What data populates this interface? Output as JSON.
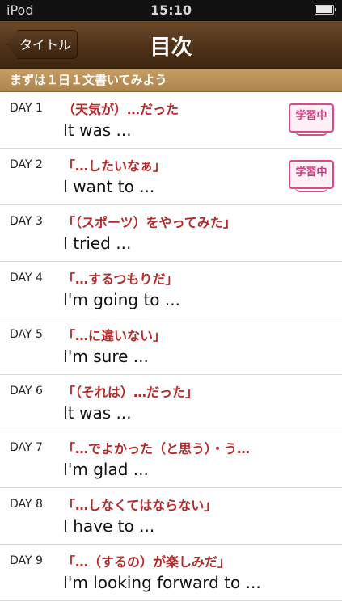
{
  "status_bar": {
    "device": "iPod",
    "time": "15:10",
    "battery_icon": "battery-icon"
  },
  "nav": {
    "back_label": "タイトル",
    "title": "目次"
  },
  "section": {
    "header": "まずは１日１文書いてみよう"
  },
  "rows": [
    {
      "day": "DAY 1",
      "jp": "（天気が）…だった",
      "en": "It was ...",
      "badge": "学習中"
    },
    {
      "day": "DAY 2",
      "jp": "「…したいなぁ」",
      "en": "I want to ...",
      "badge": "学習中"
    },
    {
      "day": "DAY 3",
      "jp": "「（スポーツ）をやってみた」",
      "en": "I tried ...",
      "badge": ""
    },
    {
      "day": "DAY 4",
      "jp": "「…するつもりだ」",
      "en": "I'm going to ...",
      "badge": ""
    },
    {
      "day": "DAY 5",
      "jp": "「…に違いない」",
      "en": "I'm sure ...",
      "badge": ""
    },
    {
      "day": "DAY 6",
      "jp": "「（それは）…だった」",
      "en": "It was ...",
      "badge": ""
    },
    {
      "day": "DAY 7",
      "jp": "「…でよかった（と思う）・う…",
      "en": "I'm glad ...",
      "badge": ""
    },
    {
      "day": "DAY 8",
      "jp": "「…しなくてはならない」",
      "en": "I have to ...",
      "badge": ""
    },
    {
      "day": "DAY 9",
      "jp": "「…（するの）が楽しみだ」",
      "en": "I'm looking forward to ...",
      "badge": ""
    }
  ],
  "colors": {
    "nav_brown": "#4f3219",
    "section_tan": "#c79e66",
    "japanese_red": "#b52a2a",
    "badge_pink": "#d64c8a"
  }
}
